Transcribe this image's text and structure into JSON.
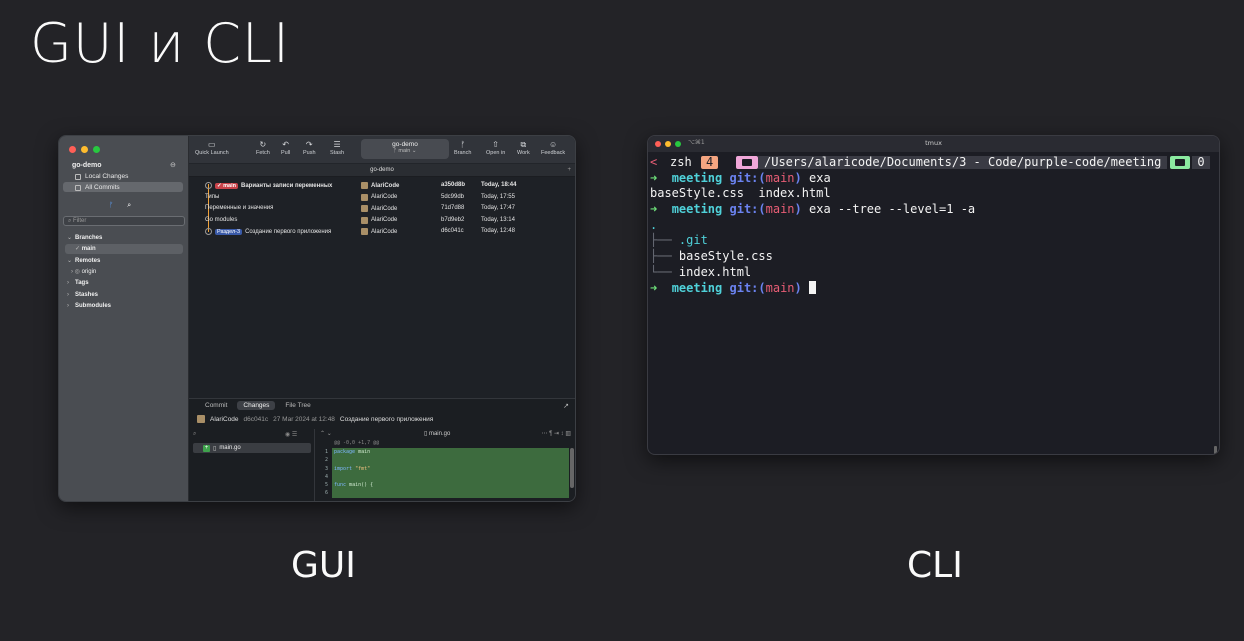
{
  "slide": {
    "title": "GUI и CLI",
    "caption_gui": "GUI",
    "caption_cli": "CLI"
  },
  "gui": {
    "sidebar": {
      "repo": "go-demo",
      "local_changes": "Local Changes",
      "all_commits": "All Commits",
      "filter_placeholder": "Filter",
      "branches": "Branches",
      "branch_main": "main",
      "remotes": "Remotes",
      "remote_origin": "origin",
      "tags": "Tags",
      "stashes": "Stashes",
      "submodules": "Submodules"
    },
    "toolbar": {
      "quick_launch": "Quick Launch",
      "fetch": "Fetch",
      "pull": "Pull",
      "push": "Push",
      "stash": "Stash",
      "repo": "go-demo",
      "branch": "main",
      "branch_btn": "Branch",
      "open_in": "Open in",
      "work": "Work",
      "feedback": "Feedback"
    },
    "tab": "go-demo",
    "commits": [
      {
        "badge": "main",
        "message": "Варианты записи переменных",
        "author": "AlariCode",
        "sha": "a350d8b",
        "date": "Today, 18:44"
      },
      {
        "message": "Типы",
        "author": "AlariCode",
        "sha": "5dc99db",
        "date": "Today, 17:55"
      },
      {
        "message": "Переменные и значения",
        "author": "AlariCode",
        "sha": "71d7d88",
        "date": "Today, 17:47"
      },
      {
        "message": "Go modules",
        "author": "AlariCode",
        "sha": "b7d9eb2",
        "date": "Today, 13:14"
      },
      {
        "badge": "Раздел-3",
        "message": "Создание первого приложения",
        "author": "AlariCode",
        "sha": "d6c041c",
        "date": "Today, 12:48"
      }
    ],
    "lower": {
      "tab_commit": "Commit",
      "tab_changes": "Changes",
      "tab_filetree": "File Tree",
      "author": "AlariCode",
      "sha": "d6c041c",
      "date": "27 Mar 2024 at 12:48",
      "message": "Создание первого приложения",
      "file": "main.go",
      "hunk": "@@ -0,0 +1,7 @@",
      "diff": [
        {
          "n": "1",
          "kw": "package",
          "rest": " main"
        },
        {
          "n": "2",
          "kw": "",
          "rest": ""
        },
        {
          "n": "3",
          "kw": "import",
          "rest": " \"fmt\""
        },
        {
          "n": "4",
          "kw": "",
          "rest": ""
        },
        {
          "n": "5",
          "kw": "func",
          "rest": " main() {"
        },
        {
          "n": "6",
          "kw": "",
          "rest": ""
        }
      ]
    }
  },
  "cli": {
    "shortcut": "⌥⌘1",
    "title": "tmux",
    "status": {
      "back": "<",
      "shell": "zsh",
      "count": "4",
      "path": "/Users/alaricode/Documents/3 - Code/purple-code/meeting",
      "panes": "0"
    },
    "lines": [
      {
        "dir": "meeting",
        "git": "git:(",
        "branch": "main",
        "close": ")",
        "cmd": " exa"
      },
      {
        "plain": "baseStyle.css  index.html"
      },
      {
        "dir": "meeting",
        "git": "git:(",
        "branch": "main",
        "close": ")",
        "cmd": " exa --tree --level=1 -a"
      }
    ],
    "tree": {
      "root": ".",
      "items": [
        ".git",
        "baseStyle.css",
        "index.html"
      ]
    },
    "prompt": {
      "dir": "meeting",
      "git": "git:(",
      "branch": "main",
      "close": ")"
    }
  },
  "colors": {
    "accent_green": "#6ee07a",
    "accent_red": "#e85d75",
    "accent_cyan": "#4fd1d9",
    "bg": "#232327"
  }
}
